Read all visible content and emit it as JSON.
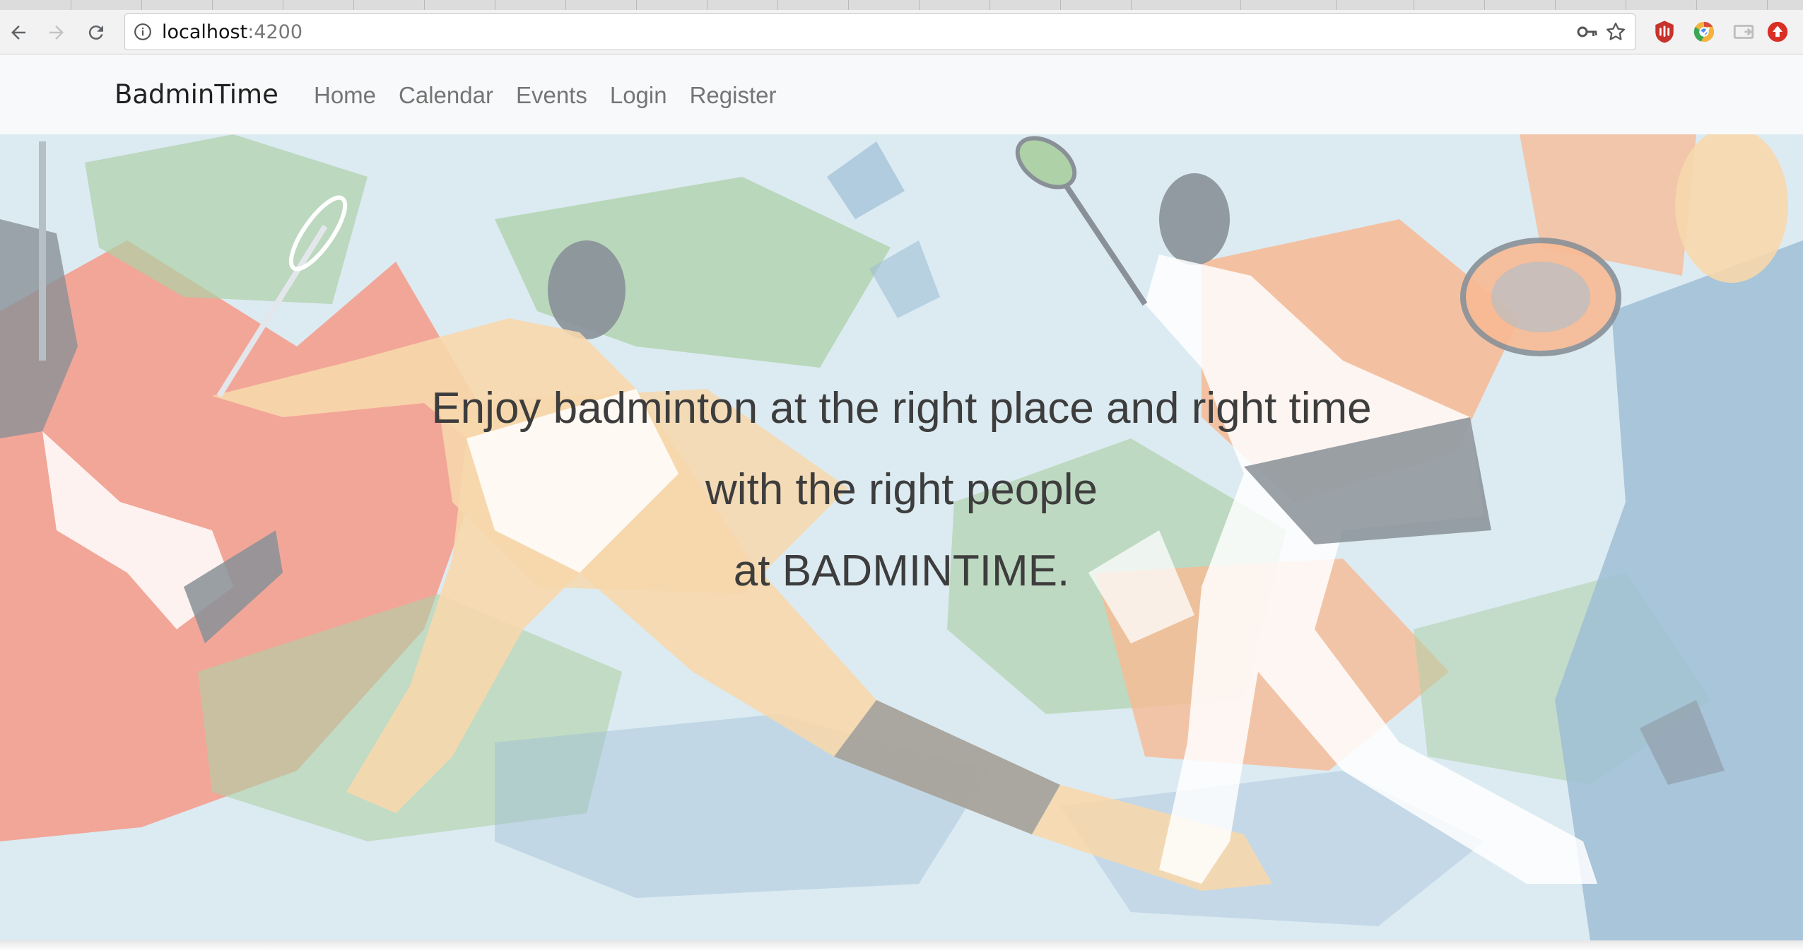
{
  "browser": {
    "url_host": "localhost",
    "url_port": ":4200",
    "icons": [
      "back-icon",
      "forward-icon",
      "reload-icon",
      "info-icon",
      "key-icon",
      "bookmark-star-icon"
    ],
    "extensions": [
      "ublock-icon",
      "chrome-ext-icon",
      "cast-icon",
      "update-icon"
    ]
  },
  "navbar": {
    "brand": "BadminTime",
    "links": [
      "Home",
      "Calendar",
      "Events",
      "Login",
      "Register"
    ]
  },
  "hero": {
    "line1": "Enjoy badminton at the right place and right time",
    "line2": "with the right people",
    "line3": "at BADMINTIME.",
    "palette": {
      "sky": "#cfe3ee",
      "orange": "#f5a06a",
      "red": "#f2735a",
      "green": "#8fbf86",
      "blue": "#7aa6c6",
      "skin": "#f4c98d",
      "dark": "#5c6670"
    }
  }
}
